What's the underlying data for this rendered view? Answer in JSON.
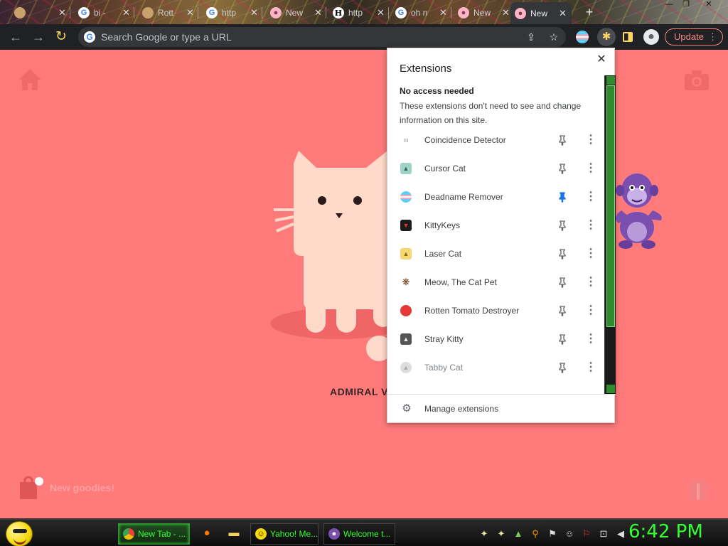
{
  "browser": {
    "tabs": [
      {
        "title": "",
        "favicon": "image-favicon"
      },
      {
        "title": "bi - ",
        "favicon": "google-favicon"
      },
      {
        "title": "Rott",
        "favicon": "image-favicon"
      },
      {
        "title": "http",
        "favicon": "google-favicon"
      },
      {
        "title": "New",
        "favicon": "cat-favicon"
      },
      {
        "title": "http",
        "favicon": "h-favicon"
      },
      {
        "title": "oh n",
        "favicon": "google-favicon"
      },
      {
        "title": "New",
        "favicon": "cat-favicon"
      },
      {
        "title": "New",
        "favicon": "cat-favicon",
        "active": true
      }
    ],
    "new_tab_label": "+",
    "omnibox_placeholder": "Search Google or type a URL",
    "update_label": "Update"
  },
  "page": {
    "cat_name": "ADMIRAL V",
    "new_goodies": "New goodies!"
  },
  "extensions_popup": {
    "title": "Extensions",
    "section_heading": "No access needed",
    "section_description": "These extensions don't need to see and change information on this site.",
    "items": [
      {
        "name": "Coincidence Detector",
        "icon": "coincidence-icon",
        "pinned": false
      },
      {
        "name": "Cursor Cat",
        "icon": "cursor-cat-icon",
        "pinned": false
      },
      {
        "name": "Deadname Remover",
        "icon": "trans-flag-icon",
        "pinned": true
      },
      {
        "name": "KittyKeys",
        "icon": "kittykeys-icon",
        "pinned": false
      },
      {
        "name": "Laser Cat",
        "icon": "laser-cat-icon",
        "pinned": false
      },
      {
        "name": "Meow, The Cat Pet",
        "icon": "paw-icon",
        "pinned": false
      },
      {
        "name": "Rotten Tomato Destroyer",
        "icon": "tomato-icon",
        "pinned": false
      },
      {
        "name": "Stray Kitty",
        "icon": "stray-kitty-icon",
        "pinned": false
      },
      {
        "name": "Tabby Cat",
        "icon": "tabby-cat-icon",
        "pinned": false,
        "dimmed": true
      }
    ],
    "manage_label": "Manage extensions"
  },
  "taskbar": {
    "tasks": [
      {
        "label": "New Tab - ...",
        "icon": "chrome-icon",
        "active": true
      },
      {
        "label": "Yahoo! Me...",
        "icon": "yahoo-icon",
        "active": false
      },
      {
        "label": "Welcome t...",
        "icon": "bonzi-icon",
        "active": false
      }
    ],
    "clock": "6:42 PM"
  },
  "colors": {
    "page_background": "#ff7b7b",
    "accent_yellow": "#fdd663",
    "update_red": "#f28b82",
    "pin_blue": "#1a73e8",
    "taskbar_green": "#33ff33"
  }
}
